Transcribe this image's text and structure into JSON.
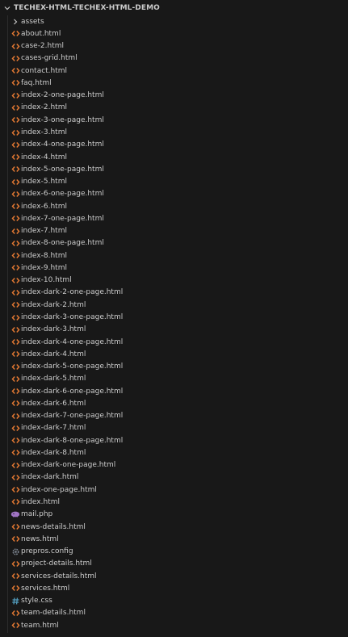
{
  "explorer": {
    "root_title": "TECHEX-HTML-TECHEX-HTML-DEMO",
    "items": [
      {
        "label": "assets",
        "kind": "folder"
      },
      {
        "label": "about.html",
        "kind": "html"
      },
      {
        "label": "case-2.html",
        "kind": "html"
      },
      {
        "label": "cases-grid.html",
        "kind": "html"
      },
      {
        "label": "contact.html",
        "kind": "html"
      },
      {
        "label": "faq.html",
        "kind": "html"
      },
      {
        "label": "index-2-one-page.html",
        "kind": "html"
      },
      {
        "label": "index-2.html",
        "kind": "html"
      },
      {
        "label": "index-3-one-page.html",
        "kind": "html"
      },
      {
        "label": "index-3.html",
        "kind": "html"
      },
      {
        "label": "index-4-one-page.html",
        "kind": "html"
      },
      {
        "label": "index-4.html",
        "kind": "html"
      },
      {
        "label": "index-5-one-page.html",
        "kind": "html"
      },
      {
        "label": "index-5.html",
        "kind": "html"
      },
      {
        "label": "index-6-one-page.html",
        "kind": "html"
      },
      {
        "label": "index-6.html",
        "kind": "html"
      },
      {
        "label": "index-7-one-page.html",
        "kind": "html"
      },
      {
        "label": "index-7.html",
        "kind": "html"
      },
      {
        "label": "index-8-one-page.html",
        "kind": "html"
      },
      {
        "label": "index-8.html",
        "kind": "html"
      },
      {
        "label": "index-9.html",
        "kind": "html"
      },
      {
        "label": "index-10.html",
        "kind": "html"
      },
      {
        "label": "index-dark-2-one-page.html",
        "kind": "html"
      },
      {
        "label": "index-dark-2.html",
        "kind": "html"
      },
      {
        "label": "index-dark-3-one-page.html",
        "kind": "html"
      },
      {
        "label": "index-dark-3.html",
        "kind": "html"
      },
      {
        "label": "index-dark-4-one-page.html",
        "kind": "html"
      },
      {
        "label": "index-dark-4.html",
        "kind": "html"
      },
      {
        "label": "index-dark-5-one-page.html",
        "kind": "html"
      },
      {
        "label": "index-dark-5.html",
        "kind": "html"
      },
      {
        "label": "index-dark-6-one-page.html",
        "kind": "html"
      },
      {
        "label": "index-dark-6.html",
        "kind": "html"
      },
      {
        "label": "index-dark-7-one-page.html",
        "kind": "html"
      },
      {
        "label": "index-dark-7.html",
        "kind": "html"
      },
      {
        "label": "index-dark-8-one-page.html",
        "kind": "html"
      },
      {
        "label": "index-dark-8.html",
        "kind": "html"
      },
      {
        "label": "index-dark-one-page.html",
        "kind": "html"
      },
      {
        "label": "index-dark.html",
        "kind": "html"
      },
      {
        "label": "index-one-page.html",
        "kind": "html"
      },
      {
        "label": "index.html",
        "kind": "html"
      },
      {
        "label": "mail.php",
        "kind": "php"
      },
      {
        "label": "news-details.html",
        "kind": "html"
      },
      {
        "label": "news.html",
        "kind": "html"
      },
      {
        "label": "prepros.config",
        "kind": "config"
      },
      {
        "label": "project-details.html",
        "kind": "html"
      },
      {
        "label": "services-details.html",
        "kind": "html"
      },
      {
        "label": "services.html",
        "kind": "html"
      },
      {
        "label": "style.css",
        "kind": "css"
      },
      {
        "label": "team-details.html",
        "kind": "html"
      },
      {
        "label": "team.html",
        "kind": "html"
      }
    ]
  },
  "icons": {
    "root": "chevron-down-icon",
    "folder": "chevron-right-icon",
    "html": "html-file-icon",
    "php": "php-file-icon",
    "config": "gear-icon",
    "css": "css-file-icon"
  },
  "colors": {
    "background": "#181818",
    "text": "#cccccc",
    "html_icon": "#e37933",
    "php_icon": "#a074c4",
    "css_icon": "#519aba",
    "config_icon": "#7d8590"
  }
}
